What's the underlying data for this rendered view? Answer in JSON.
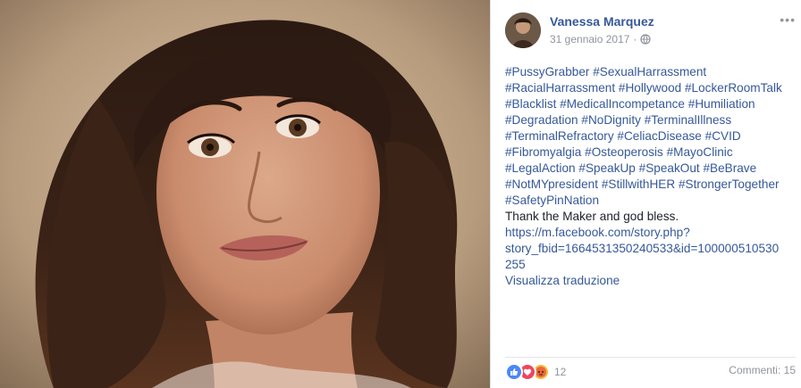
{
  "post": {
    "author": "Vanessa Marquez",
    "date": "31 gennaio 2017",
    "separator": "·",
    "more": "•••",
    "hashtags_lines": [
      [
        "#PussyGrabber",
        "#SexualHarrassment"
      ],
      [
        "#RacialHarrassment",
        "#Hollywood",
        "#LockerRoomTalk"
      ],
      [
        "#Blacklist",
        "#MedicalIncompetance",
        "#Humiliation"
      ],
      [
        "#Degradation",
        "#NoDignity",
        "#TerminalIllness"
      ],
      [
        "#TerminalRefractory",
        "#CeliacDisease",
        "#CVID"
      ],
      [
        "#Fibromyalgia",
        "#Osteoperosis",
        "#MayoClinic"
      ],
      [
        "#LegalAction",
        "#SpeakUp",
        "#SpeakOut",
        "#BeBrave"
      ],
      [
        "#NotMYpresident",
        "#StillwithHER",
        "#StrongerTogether"
      ],
      [
        "#SafetyPinNation"
      ]
    ],
    "message": "Thank the Maker and god bless.",
    "link": "https://m.facebook.com/story.php?story_fbid=1664531350240533&id=100000510530255",
    "link_lines": [
      "https://m.facebook.com/story.php?",
      "story_fbid=1664531350240533&id=100000510530",
      "255"
    ],
    "translate_label": "Visualizza traduzione"
  },
  "footer": {
    "reaction_count": "12",
    "comments_label": "Commenti: 15"
  },
  "colors": {
    "link": "#365899",
    "muted": "#90949c",
    "text": "#1d2129"
  }
}
